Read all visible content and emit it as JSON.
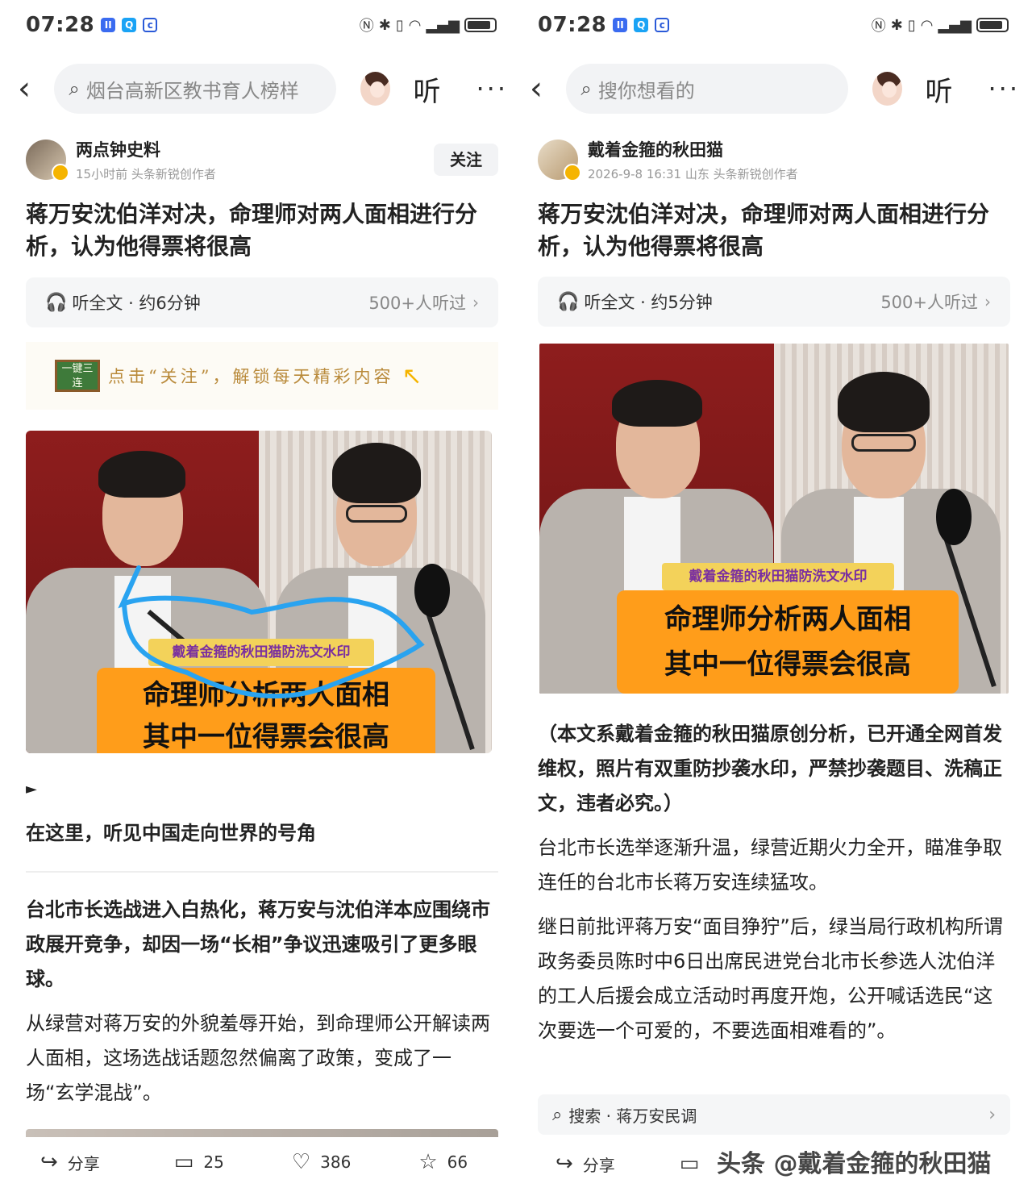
{
  "left": {
    "status": {
      "time": "07:28"
    },
    "search_placeholder": "烟台高新区教书育人榜样",
    "listen_label": "听",
    "more_label": "···",
    "author": {
      "name": "两点钟史料",
      "meta": "15小时前  头条新锐创作者",
      "follow": "关注"
    },
    "title": "蒋万安沈伯洋对决，命理师对两人面相进行分析，认为他得票将很高",
    "listenbar": {
      "label": "听全文 · 约6分钟",
      "count": "500+人听过"
    },
    "banner": {
      "board": "一键三连",
      "text": "点击“关注”，解锁每天精彩内容"
    },
    "photo": {
      "watermark": "戴着金箍的秋田猫防洗文水印",
      "caption_line1": "命理师分析两人面相",
      "caption_line2": "其中一位得票会很高"
    },
    "arrow_label": "►",
    "subtitle": "在这里，听见中国走向世界的号角",
    "para1": "台北市长选战进入白热化，蒋万安与沈伯洋本应围绕市政展开竞争，却因一场“长相”争议迅速吸引了更多眼球。",
    "para2": "从绿营对蒋万安的外貌羞辱开始，到命理师公开解读两人面相，这场选战话题忽然偏离了政策，变成了一场“玄学混战”。",
    "actions": {
      "share": "分享",
      "comments": "25",
      "likes": "386",
      "favorites": "66"
    }
  },
  "right": {
    "status": {
      "time": "07:28"
    },
    "search_placeholder": "搜你想看的",
    "listen_label": "听",
    "more_label": "···",
    "author": {
      "name": "戴着金箍的秋田猫",
      "meta": "2026-9-8  16:31  山东  头条新锐创作者"
    },
    "title": "蒋万安沈伯洋对决，命理师对两人面相进行分析，认为他得票将很高",
    "listenbar": {
      "label": "听全文 · 约5分钟",
      "count": "500+人听过"
    },
    "photo": {
      "watermark": "戴着金箍的秋田猫防洗文水印",
      "caption_line1": "命理师分析两人面相",
      "caption_line2": "其中一位得票会很高"
    },
    "para1": "（本文系戴着金箍的秋田猫原创分析，已开通全网首发维权，照片有双重防抄袭水印，严禁抄袭题目、洗稿正文，违者必究。）",
    "para2": "台北市长选举逐渐升温，绿营近期火力全开，瞄准争取连任的台北市长蒋万安连续猛攻。",
    "para3": "继日前批评蒋万安“面目狰狞”后，绿当局行政机构所谓政务委员陈时中6日出席民进党台北市长参选人沈伯洋的工人后援会成立活动时再度开炮，公开喊话选民“这次要选一个可爱的，不要选面相难看的”。",
    "searchbar": "搜索 · 蒋万安民调",
    "actions": {
      "share": "分享"
    },
    "watermark": "头条 @戴着金箍的秋田猫"
  },
  "colors": {
    "accent_orange": "#ff9d1a",
    "annotation_blue": "#29a3f0",
    "watermark_yellow": "#f3d25a"
  }
}
